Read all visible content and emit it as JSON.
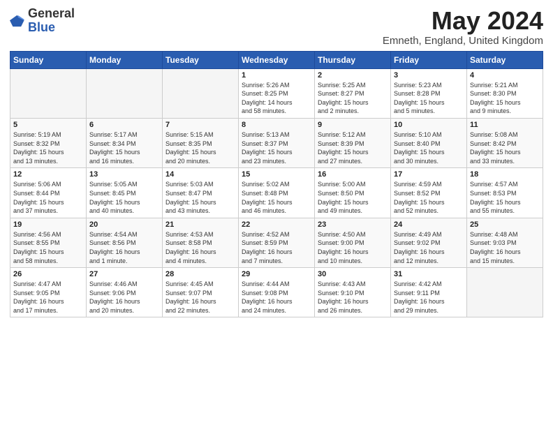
{
  "logo": {
    "general": "General",
    "blue": "Blue"
  },
  "title": "May 2024",
  "subtitle": "Emneth, England, United Kingdom",
  "days_of_week": [
    "Sunday",
    "Monday",
    "Tuesday",
    "Wednesday",
    "Thursday",
    "Friday",
    "Saturday"
  ],
  "weeks": [
    [
      {
        "day": "",
        "detail": ""
      },
      {
        "day": "",
        "detail": ""
      },
      {
        "day": "",
        "detail": ""
      },
      {
        "day": "1",
        "detail": "Sunrise: 5:26 AM\nSunset: 8:25 PM\nDaylight: 14 hours\nand 58 minutes."
      },
      {
        "day": "2",
        "detail": "Sunrise: 5:25 AM\nSunset: 8:27 PM\nDaylight: 15 hours\nand 2 minutes."
      },
      {
        "day": "3",
        "detail": "Sunrise: 5:23 AM\nSunset: 8:28 PM\nDaylight: 15 hours\nand 5 minutes."
      },
      {
        "day": "4",
        "detail": "Sunrise: 5:21 AM\nSunset: 8:30 PM\nDaylight: 15 hours\nand 9 minutes."
      }
    ],
    [
      {
        "day": "5",
        "detail": "Sunrise: 5:19 AM\nSunset: 8:32 PM\nDaylight: 15 hours\nand 13 minutes."
      },
      {
        "day": "6",
        "detail": "Sunrise: 5:17 AM\nSunset: 8:34 PM\nDaylight: 15 hours\nand 16 minutes."
      },
      {
        "day": "7",
        "detail": "Sunrise: 5:15 AM\nSunset: 8:35 PM\nDaylight: 15 hours\nand 20 minutes."
      },
      {
        "day": "8",
        "detail": "Sunrise: 5:13 AM\nSunset: 8:37 PM\nDaylight: 15 hours\nand 23 minutes."
      },
      {
        "day": "9",
        "detail": "Sunrise: 5:12 AM\nSunset: 8:39 PM\nDaylight: 15 hours\nand 27 minutes."
      },
      {
        "day": "10",
        "detail": "Sunrise: 5:10 AM\nSunset: 8:40 PM\nDaylight: 15 hours\nand 30 minutes."
      },
      {
        "day": "11",
        "detail": "Sunrise: 5:08 AM\nSunset: 8:42 PM\nDaylight: 15 hours\nand 33 minutes."
      }
    ],
    [
      {
        "day": "12",
        "detail": "Sunrise: 5:06 AM\nSunset: 8:44 PM\nDaylight: 15 hours\nand 37 minutes."
      },
      {
        "day": "13",
        "detail": "Sunrise: 5:05 AM\nSunset: 8:45 PM\nDaylight: 15 hours\nand 40 minutes."
      },
      {
        "day": "14",
        "detail": "Sunrise: 5:03 AM\nSunset: 8:47 PM\nDaylight: 15 hours\nand 43 minutes."
      },
      {
        "day": "15",
        "detail": "Sunrise: 5:02 AM\nSunset: 8:48 PM\nDaylight: 15 hours\nand 46 minutes."
      },
      {
        "day": "16",
        "detail": "Sunrise: 5:00 AM\nSunset: 8:50 PM\nDaylight: 15 hours\nand 49 minutes."
      },
      {
        "day": "17",
        "detail": "Sunrise: 4:59 AM\nSunset: 8:52 PM\nDaylight: 15 hours\nand 52 minutes."
      },
      {
        "day": "18",
        "detail": "Sunrise: 4:57 AM\nSunset: 8:53 PM\nDaylight: 15 hours\nand 55 minutes."
      }
    ],
    [
      {
        "day": "19",
        "detail": "Sunrise: 4:56 AM\nSunset: 8:55 PM\nDaylight: 15 hours\nand 58 minutes."
      },
      {
        "day": "20",
        "detail": "Sunrise: 4:54 AM\nSunset: 8:56 PM\nDaylight: 16 hours\nand 1 minute."
      },
      {
        "day": "21",
        "detail": "Sunrise: 4:53 AM\nSunset: 8:58 PM\nDaylight: 16 hours\nand 4 minutes."
      },
      {
        "day": "22",
        "detail": "Sunrise: 4:52 AM\nSunset: 8:59 PM\nDaylight: 16 hours\nand 7 minutes."
      },
      {
        "day": "23",
        "detail": "Sunrise: 4:50 AM\nSunset: 9:00 PM\nDaylight: 16 hours\nand 10 minutes."
      },
      {
        "day": "24",
        "detail": "Sunrise: 4:49 AM\nSunset: 9:02 PM\nDaylight: 16 hours\nand 12 minutes."
      },
      {
        "day": "25",
        "detail": "Sunrise: 4:48 AM\nSunset: 9:03 PM\nDaylight: 16 hours\nand 15 minutes."
      }
    ],
    [
      {
        "day": "26",
        "detail": "Sunrise: 4:47 AM\nSunset: 9:05 PM\nDaylight: 16 hours\nand 17 minutes."
      },
      {
        "day": "27",
        "detail": "Sunrise: 4:46 AM\nSunset: 9:06 PM\nDaylight: 16 hours\nand 20 minutes."
      },
      {
        "day": "28",
        "detail": "Sunrise: 4:45 AM\nSunset: 9:07 PM\nDaylight: 16 hours\nand 22 minutes."
      },
      {
        "day": "29",
        "detail": "Sunrise: 4:44 AM\nSunset: 9:08 PM\nDaylight: 16 hours\nand 24 minutes."
      },
      {
        "day": "30",
        "detail": "Sunrise: 4:43 AM\nSunset: 9:10 PM\nDaylight: 16 hours\nand 26 minutes."
      },
      {
        "day": "31",
        "detail": "Sunrise: 4:42 AM\nSunset: 9:11 PM\nDaylight: 16 hours\nand 29 minutes."
      },
      {
        "day": "",
        "detail": ""
      }
    ]
  ]
}
